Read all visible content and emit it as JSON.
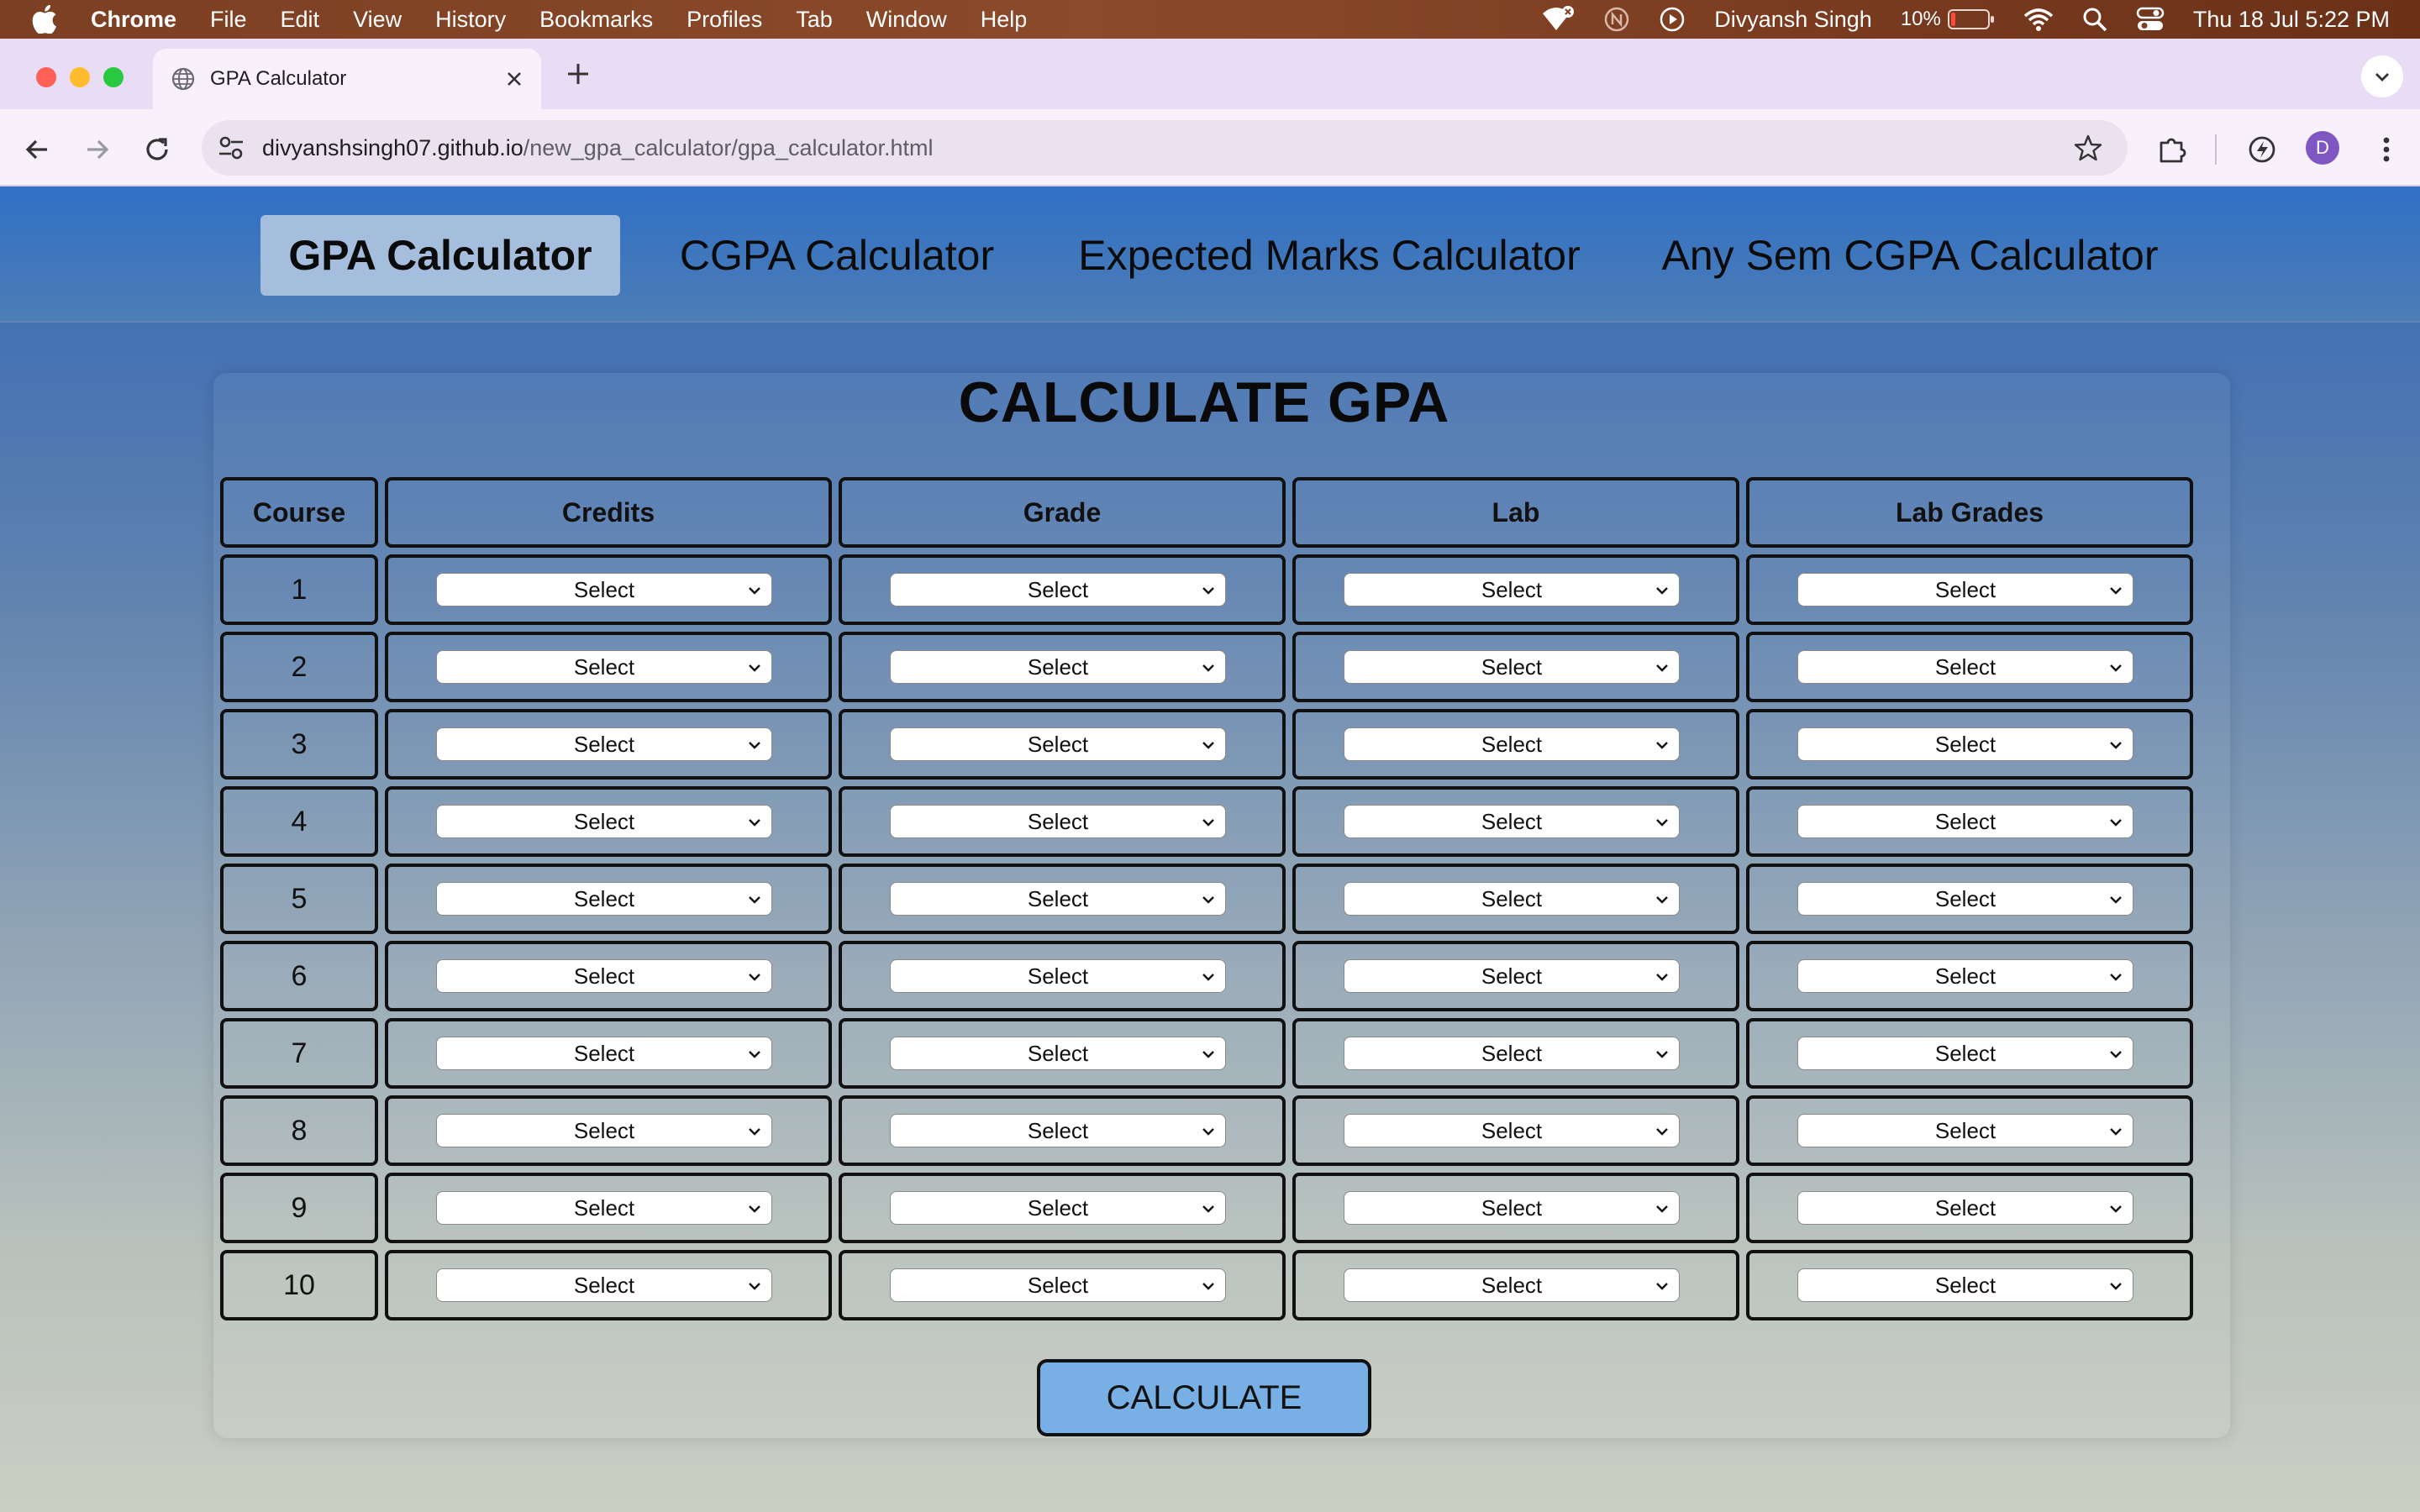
{
  "menubar": {
    "app_name": "Chrome",
    "items": [
      "File",
      "Edit",
      "View",
      "History",
      "Bookmarks",
      "Profiles",
      "Tab",
      "Window",
      "Help"
    ],
    "user_name": "Divyansh Singh",
    "battery_percent": "10%",
    "clock": "Thu 18 Jul  5:22 PM"
  },
  "browser": {
    "tab_title": "GPA Calculator",
    "url_host": "divyanshsingh07.github.io",
    "url_path": "/new_gpa_calculator/gpa_calculator.html",
    "profile_initial": "D"
  },
  "nav": {
    "links": [
      "GPA Calculator",
      "CGPA Calculator",
      "Expected Marks Calculator",
      "Any Sem CGPA Calculator"
    ],
    "active_index": 0
  },
  "page": {
    "title": "CALCULATE GPA",
    "columns": [
      "Course",
      "Credits",
      "Grade",
      "Lab",
      "Lab Grades"
    ],
    "select_placeholder": "Select",
    "rows": [
      {
        "course": "1",
        "credits": "Select",
        "grade": "Select",
        "lab": "Select",
        "lab_grade": "Select"
      },
      {
        "course": "2",
        "credits": "Select",
        "grade": "Select",
        "lab": "Select",
        "lab_grade": "Select"
      },
      {
        "course": "3",
        "credits": "Select",
        "grade": "Select",
        "lab": "Select",
        "lab_grade": "Select"
      },
      {
        "course": "4",
        "credits": "Select",
        "grade": "Select",
        "lab": "Select",
        "lab_grade": "Select"
      },
      {
        "course": "5",
        "credits": "Select",
        "grade": "Select",
        "lab": "Select",
        "lab_grade": "Select"
      },
      {
        "course": "6",
        "credits": "Select",
        "grade": "Select",
        "lab": "Select",
        "lab_grade": "Select"
      },
      {
        "course": "7",
        "credits": "Select",
        "grade": "Select",
        "lab": "Select",
        "lab_grade": "Select"
      },
      {
        "course": "8",
        "credits": "Select",
        "grade": "Select",
        "lab": "Select",
        "lab_grade": "Select"
      },
      {
        "course": "9",
        "credits": "Select",
        "grade": "Select",
        "lab": "Select",
        "lab_grade": "Select"
      },
      {
        "course": "10",
        "credits": "Select",
        "grade": "Select",
        "lab": "Select",
        "lab_grade": "Select"
      }
    ],
    "calculate_label": "CALCULATE"
  },
  "colors": {
    "nav_active_bg": "#a6bede",
    "button_bg": "#78afe4",
    "page_gradient_top": "#3468b6",
    "page_gradient_bottom": "#cbcfc3"
  }
}
